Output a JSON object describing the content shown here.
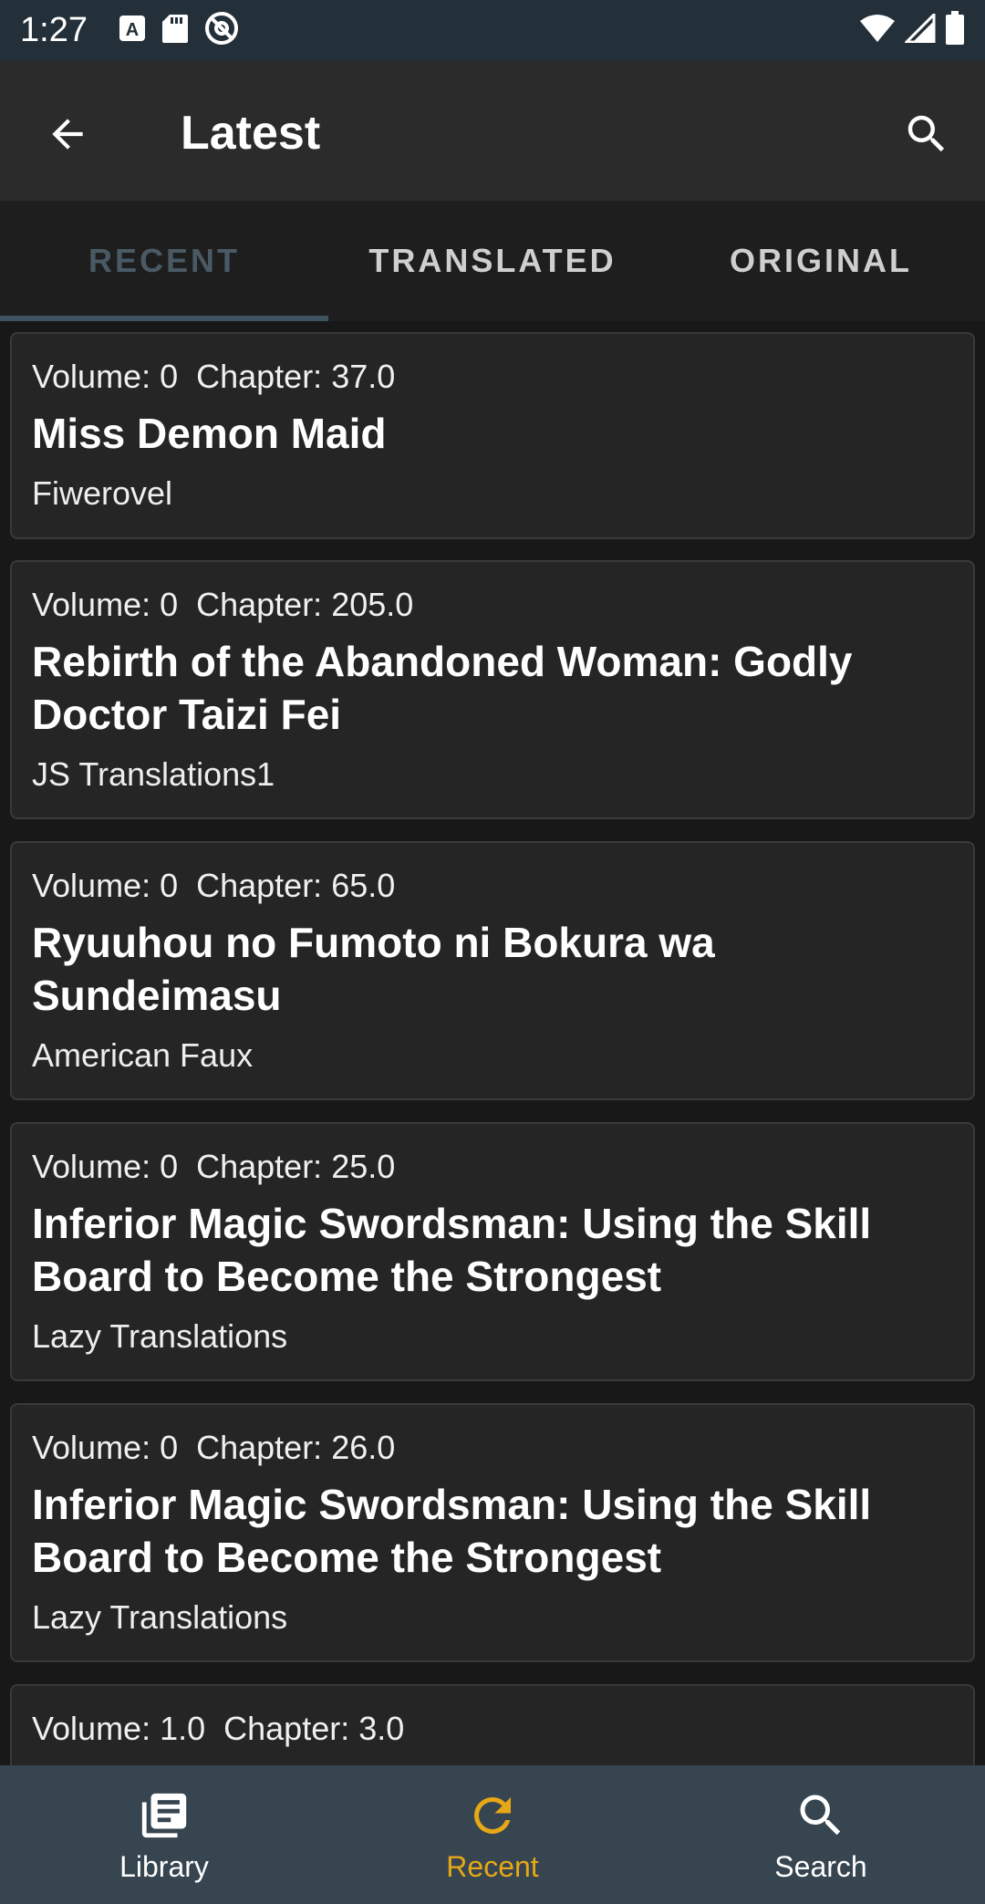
{
  "status": {
    "time": "1:27"
  },
  "app_bar": {
    "title": "Latest"
  },
  "tabs": [
    {
      "label": "RECENT",
      "active": true
    },
    {
      "label": "TRANSLATED",
      "active": false
    },
    {
      "label": "ORIGINAL",
      "active": false
    }
  ],
  "cards": [
    {
      "volume": "Volume: 0",
      "chapter": "Chapter: 37.0",
      "title": "Miss Demon Maid",
      "group": "Fiwerovel"
    },
    {
      "volume": "Volume: 0",
      "chapter": "Chapter: 205.0",
      "title": "Rebirth of the Abandoned Woman: Godly Doctor Taizi Fei",
      "group": "JS Translations1"
    },
    {
      "volume": "Volume: 0",
      "chapter": "Chapter: 65.0",
      "title": "Ryuuhou no Fumoto ni Bokura wa Sundeimasu",
      "group": "American Faux"
    },
    {
      "volume": "Volume: 0",
      "chapter": "Chapter: 25.0",
      "title": "Inferior Magic Swordsman: Using the Skill Board to Become the Strongest",
      "group": "Lazy Translations"
    },
    {
      "volume": "Volume: 0",
      "chapter": "Chapter: 26.0",
      "title": "Inferior Magic Swordsman: Using the Skill Board to Become the Strongest",
      "group": "Lazy Translations"
    },
    {
      "volume": "Volume: 1.0",
      "chapter": "Chapter: 3.0",
      "title": "",
      "group": ""
    }
  ],
  "bottom_nav": [
    {
      "label": "Library",
      "icon": "library-icon",
      "active": false
    },
    {
      "label": "Recent",
      "icon": "refresh-icon",
      "active": true
    },
    {
      "label": "Search",
      "icon": "search-icon",
      "active": false
    }
  ],
  "colors": {
    "accent": "#e6a817",
    "tab_indicator": "#3d5360",
    "app_bar": "#2b2b2b",
    "status_bar": "#243039",
    "bottom_nav": "#36454f",
    "card": "#252525"
  }
}
